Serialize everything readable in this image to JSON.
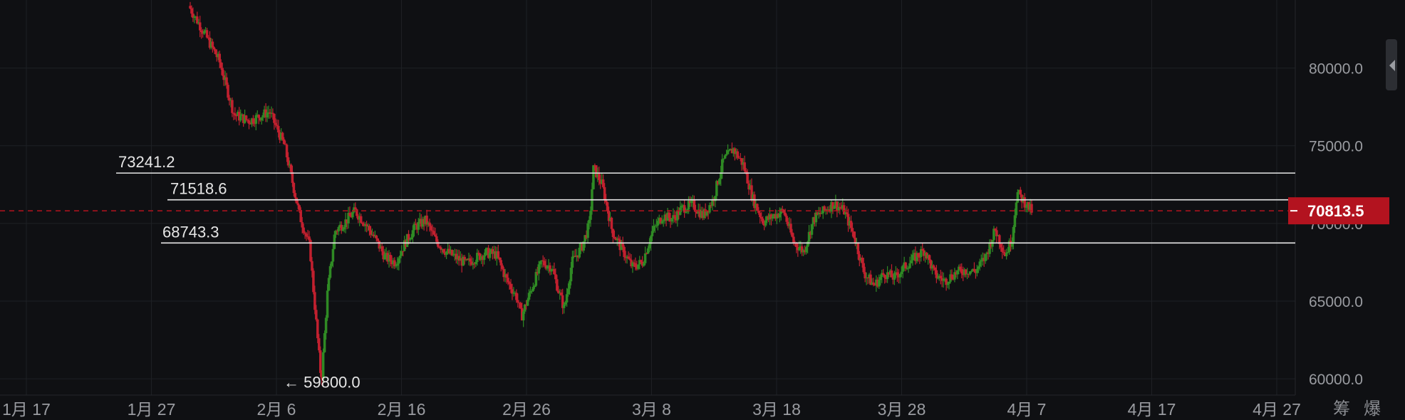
{
  "chart_data": {
    "type": "candlestick",
    "x_ticks": [
      "1月 17",
      "1月 27",
      "2月 6",
      "2月 16",
      "2月 26",
      "3月 8",
      "3月 18",
      "3月 28",
      "4月 7",
      "4月 17",
      "4月 27"
    ],
    "y_ticks": [
      "80000.0",
      "75000.0",
      "70000.0",
      "65000.0",
      "60000.0"
    ],
    "ylim": [
      57350,
      84380
    ],
    "grid": true,
    "horizontal_lines": [
      {
        "value": 73241.2,
        "label": "73241.2"
      },
      {
        "value": 71518.6,
        "label": "71518.6"
      },
      {
        "value": 68743.3,
        "label": "68743.3"
      }
    ],
    "current_price": {
      "value": 70813.5,
      "label": "70813.5"
    },
    "low_marker": {
      "value": 59800.0,
      "label": "← 59800.0"
    },
    "colors": {
      "up": "#2f8a24",
      "down": "#c2202f",
      "current": "#b3131f",
      "line": "#e8e8e8",
      "grid": "#1e2024"
    },
    "price_path": [
      [
        0,
        84000
      ],
      [
        3,
        82300
      ],
      [
        6,
        80500
      ],
      [
        9,
        77000
      ],
      [
        12,
        76600
      ],
      [
        16,
        77200
      ],
      [
        19,
        75000
      ],
      [
        22,
        70500
      ],
      [
        24,
        68500
      ],
      [
        25.7,
        62000
      ],
      [
        26.3,
        59800
      ],
      [
        27.5,
        65500
      ],
      [
        29,
        69500
      ],
      [
        31,
        70100
      ],
      [
        33,
        70800
      ],
      [
        35,
        70000
      ],
      [
        37,
        69000
      ],
      [
        39,
        67800
      ],
      [
        41,
        67500
      ],
      [
        43,
        68800
      ],
      [
        45,
        69800
      ],
      [
        47,
        70200
      ],
      [
        49,
        68900
      ],
      [
        51,
        68200
      ],
      [
        53,
        67800
      ],
      [
        55,
        67400
      ],
      [
        57,
        67800
      ],
      [
        59,
        68100
      ],
      [
        61,
        68000
      ],
      [
        63,
        66400
      ],
      [
        65,
        65300
      ],
      [
        66,
        64000
      ],
      [
        68,
        65800
      ],
      [
        70,
        67500
      ],
      [
        72,
        67200
      ],
      [
        73.5,
        65500
      ],
      [
        74.5,
        64500
      ],
      [
        76,
        67500
      ],
      [
        78,
        68500
      ],
      [
        79.5,
        70000
      ],
      [
        80.3,
        73600
      ],
      [
        82,
        72500
      ],
      [
        84,
        69500
      ],
      [
        86,
        68300
      ],
      [
        88,
        67200
      ],
      [
        90,
        67500
      ],
      [
        92,
        69500
      ],
      [
        94,
        70500
      ],
      [
        96,
        70300
      ],
      [
        98,
        71000
      ],
      [
        100,
        71200
      ],
      [
        102,
        70500
      ],
      [
        104,
        71500
      ],
      [
        106,
        74000
      ],
      [
        108,
        74800
      ],
      [
        110,
        73800
      ],
      [
        112,
        71500
      ],
      [
        114,
        70100
      ],
      [
        116,
        70500
      ],
      [
        118,
        70800
      ],
      [
        120,
        68800
      ],
      [
        122,
        68200
      ],
      [
        124,
        70300
      ],
      [
        126,
        70800
      ],
      [
        128,
        71300
      ],
      [
        130,
        70800
      ],
      [
        132,
        69200
      ],
      [
        134,
        66800
      ],
      [
        136,
        66000
      ],
      [
        138,
        66800
      ],
      [
        140,
        66500
      ],
      [
        142,
        67200
      ],
      [
        144,
        67800
      ],
      [
        146,
        68300
      ],
      [
        148,
        66700
      ],
      [
        150,
        66300
      ],
      [
        152,
        66800
      ],
      [
        154,
        67000
      ],
      [
        156,
        66900
      ],
      [
        158,
        67800
      ],
      [
        160,
        69600
      ],
      [
        162,
        68000
      ],
      [
        163.3,
        69000
      ],
      [
        164.3,
        72000
      ],
      [
        165.5,
        71500
      ],
      [
        166.5,
        71100
      ],
      [
        167.2,
        70800
      ]
    ]
  },
  "corner_buttons": [
    "筹",
    "爆"
  ]
}
